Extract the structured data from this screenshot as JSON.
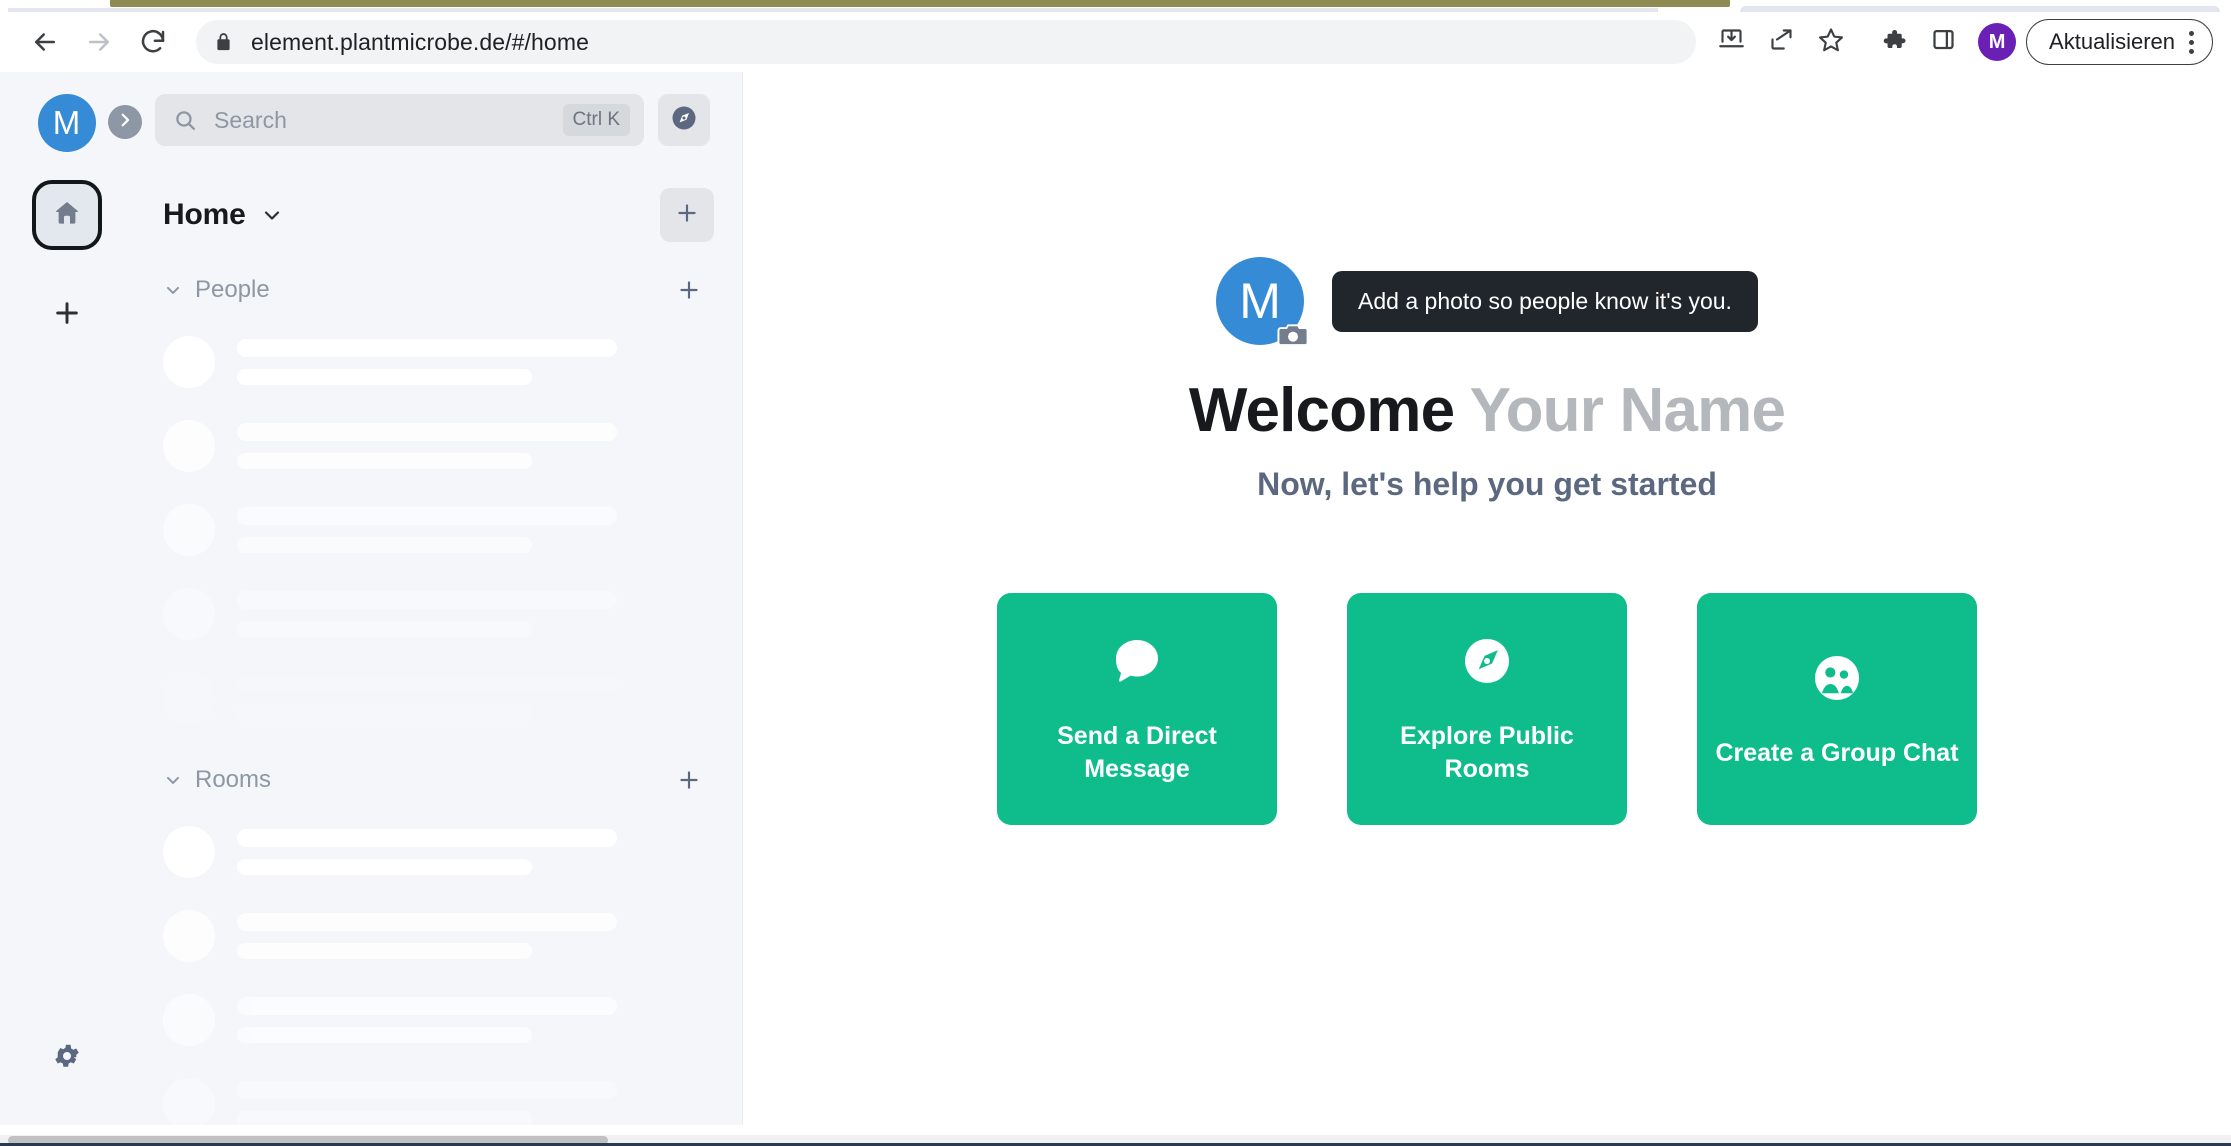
{
  "browser": {
    "url": "element.plantmicrobe.de/#/home",
    "back_tooltip": "Back",
    "forward_tooltip": "Forward",
    "reload_tooltip": "Reload",
    "update_label": "Aktualisieren",
    "profile_initial": "M",
    "icons": {
      "back": "back-arrow-icon",
      "forward": "forward-arrow-icon",
      "reload": "reload-icon",
      "lock": "lock-icon",
      "install": "install-app-icon",
      "share": "share-icon",
      "bookmark": "star-icon",
      "extensions": "puzzle-icon",
      "sidepanel": "side-panel-icon",
      "menu": "kebab-menu-icon"
    }
  },
  "space_rail": {
    "user_avatar_initial": "M",
    "expand_label": "›",
    "home_label": "Home",
    "add_space_label": "+",
    "settings_label": "Settings"
  },
  "room_panel": {
    "search": {
      "placeholder": "Search",
      "shortcut": "Ctrl K"
    },
    "explore_label": "Explore rooms",
    "header": {
      "title": "Home",
      "add_label": "+"
    },
    "sections": [
      {
        "title": "People",
        "add_label": "+",
        "placeholder_count": 5
      },
      {
        "title": "Rooms",
        "add_label": "+",
        "placeholder_count": 4
      }
    ]
  },
  "main": {
    "tooltip": "Add a photo so people know it's you.",
    "avatar_initial": "M",
    "welcome_prefix": "Welcome",
    "welcome_name": "Your Name",
    "subtitle": "Now, let's help you get started",
    "cards": [
      {
        "label": "Send a Direct Message",
        "icon": "chat-bubble-icon"
      },
      {
        "label": "Explore Public Rooms",
        "icon": "compass-icon"
      },
      {
        "label": "Create a Group Chat",
        "icon": "group-people-icon"
      }
    ]
  },
  "colors": {
    "brand_green": "#0fbd8c",
    "avatar_blue": "#368bd6",
    "profile_purple": "#6a1fb5",
    "tooltip_bg": "#21262c",
    "panel_bg": "#f4f6fa",
    "subtitle": "#5c6880"
  }
}
